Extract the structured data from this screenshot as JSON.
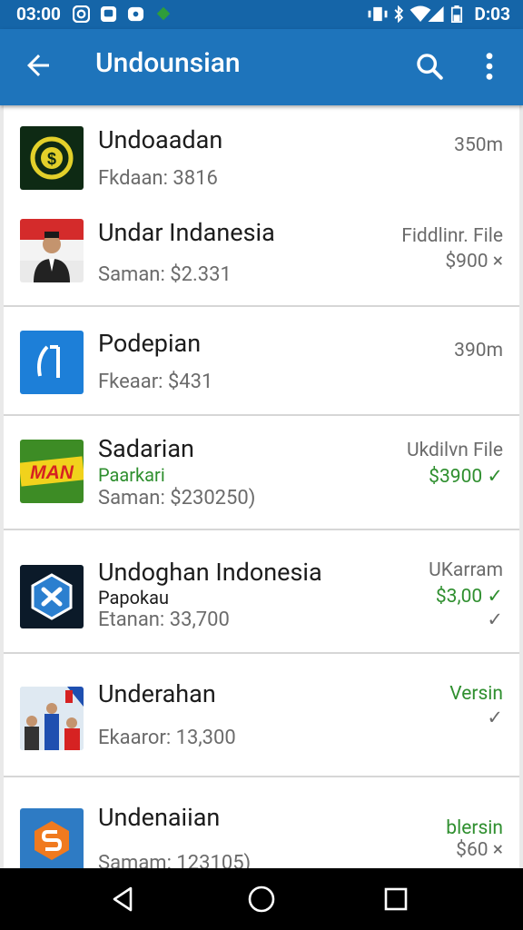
{
  "statusbar": {
    "time": "03:00",
    "right_time": "D:03"
  },
  "appbar": {
    "title": "Undounsian"
  },
  "items": [
    {
      "name": "Undoaadan",
      "sub": "Fkdaan: 3816",
      "meta": "350m",
      "price": ""
    },
    {
      "name": "Undar Indanesia",
      "sub": "Saman: $2.331",
      "meta": "Fiddlinr. File",
      "price": "$900 ×"
    },
    {
      "name": "Podepian",
      "sub": "Fkeaar: $431",
      "meta": "390m",
      "price": ""
    },
    {
      "name": "Sadarian",
      "sub_green": "Paarkari",
      "sub": "Saman: $230250)",
      "meta": "Ukdilvn File",
      "price": "$3900 ✓"
    },
    {
      "name": "Undoghan Indonesia",
      "sub_dark": "Papokau",
      "sub": "Etanan: 33,700",
      "meta": "UKarram",
      "price": "$3,00 ✓",
      "check": "✓"
    },
    {
      "name": "Underahan",
      "sub": "Ekaaror: 13,300",
      "meta": "Versin",
      "check": "✓"
    },
    {
      "name": "Undenaiian",
      "sub": "Samam: 123105)",
      "meta": "blersin",
      "price": "$60 ×"
    }
  ],
  "thumb_labels": {
    "money": "$",
    "sport": "MAN"
  }
}
